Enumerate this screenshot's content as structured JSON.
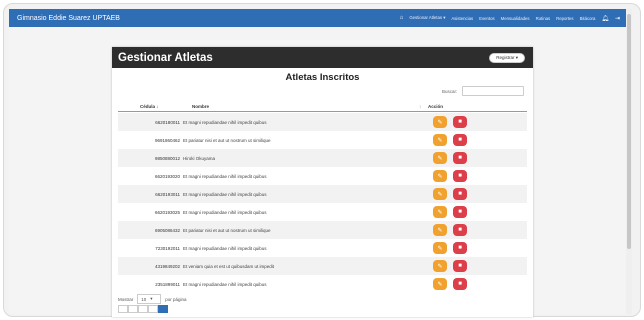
{
  "navbar": {
    "brand": "Gimnasio Eddie Suarez UPTAEB",
    "items": [
      "Gestionar Atletas ▾",
      "Asistencias",
      "Eventos",
      "Mensualidades",
      "Rutinas",
      "Reportes",
      "Bitácora"
    ]
  },
  "card": {
    "title": "Gestionar Atletas",
    "register_label": "Registrar ▾",
    "subtitle": "Atletas Inscritos",
    "search_label": "Buscar:",
    "columns": {
      "cedula": "Cédula ↓",
      "nombre": "Nombre",
      "accion": "Acción"
    },
    "rows": [
      {
        "cedula": "6620180011",
        "nombre": "Et magni repudiandae nihil impedit quibus"
      },
      {
        "cedula": "9691860462",
        "nombre": "Et pariatur nisi et aut ut nostrum ut similique"
      },
      {
        "cedula": "9850880012",
        "nombre": "Hiroki Okuyama"
      },
      {
        "cedula": "6620193020",
        "nombre": "Et magni repudiandae nihil impedit quibus"
      },
      {
        "cedula": "6620193011",
        "nombre": "Et magni repudiandae nihil impedit quibus"
      },
      {
        "cedula": "6620193025",
        "nombre": "Et magni repudiandae nihil impedit quibus"
      },
      {
        "cedula": "6905086432",
        "nombre": "Et pariatur nisi et aut ut nostrum ut similique"
      },
      {
        "cedula": "7230192011",
        "nombre": "Et magni repudiandae nihil impedit quibus"
      },
      {
        "cedula": "4319849202",
        "nombre": "Et veniam quia et est ut quibusdam ut impedit"
      },
      {
        "cedula": "2351899011",
        "nombre": "Et magni repudiandae nihil impedit quibus"
      }
    ],
    "footer": {
      "show_label": "Mostrar",
      "page_size": "10",
      "per_page_label": "por página"
    }
  },
  "colors": {
    "navbar": "#2f6db5",
    "header": "#2d2d2d",
    "edit": "#f0a12e",
    "delete": "#dc3f4a"
  }
}
